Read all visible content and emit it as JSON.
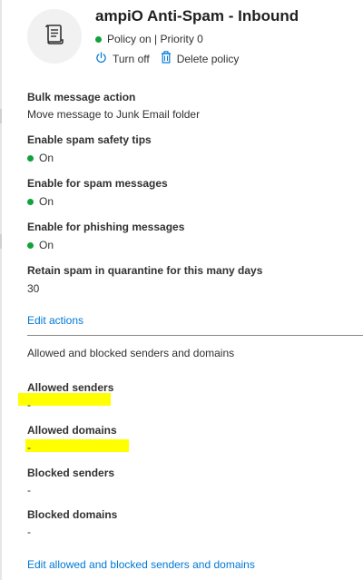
{
  "header": {
    "icon": "scroll-document-icon",
    "title": "ampiO Anti-Spam - Inbound",
    "status_text": "Policy on | Priority 0",
    "status_color": "#10a33a",
    "turn_off_label": "Turn off",
    "delete_label": "Delete policy"
  },
  "settings": [
    {
      "label": "Bulk message action",
      "value": "Move message to Junk Email folder"
    },
    {
      "label": "Enable spam safety tips",
      "value": "On"
    },
    {
      "label": "Enable for spam messages",
      "value": "On"
    },
    {
      "label": "Enable for phishing messages",
      "value": "On"
    },
    {
      "label": "Retain spam in quarantine for this many days",
      "value": "30"
    }
  ],
  "edit_actions_label": "Edit actions",
  "senders_section": {
    "heading": "Allowed and blocked senders and domains",
    "items": [
      {
        "label": "Allowed senders",
        "value": "-"
      },
      {
        "label": "Allowed domains",
        "value": "-"
      },
      {
        "label": "Blocked senders",
        "value": "-"
      },
      {
        "label": "Blocked domains",
        "value": "-"
      }
    ],
    "edit_label": "Edit allowed and blocked senders and domains"
  },
  "colors": {
    "accent": "#0078d4",
    "highlight": "#ffff00"
  }
}
